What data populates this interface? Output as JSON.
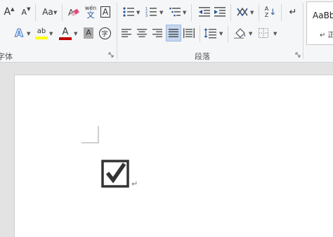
{
  "ribbon": {
    "font_group": {
      "label": "字体",
      "grow_font_glyph": "A",
      "shrink_font_glyph": "A",
      "change_case_glyph": "Aa",
      "phonetic_top": "wén",
      "phonetic_bottom": "文",
      "char_border_glyph": "A",
      "text_effects_glyph": "A",
      "highlight_glyph": "ab",
      "font_color_glyph": "A",
      "char_shading_glyph": "A",
      "enclose_char_glyph": "字",
      "highlight_color": "#ffff00",
      "font_color": "#c00000"
    },
    "paragraph_group": {
      "label": "段落",
      "sort_glyph_top": "A",
      "sort_glyph_bottom": "Z",
      "active_button": "justify"
    },
    "styles_group": {
      "preview_text": "AaBb",
      "second_line": "↵ 正"
    }
  },
  "document": {
    "checkbox_state": "checked",
    "paragraph_mark": "↵"
  },
  "colors": {
    "ribbon_bg": "#f5f6f7",
    "workspace_bg": "#e3e3e3",
    "accent": "#2b579a",
    "active_button_bg": "#c5d7ef"
  }
}
